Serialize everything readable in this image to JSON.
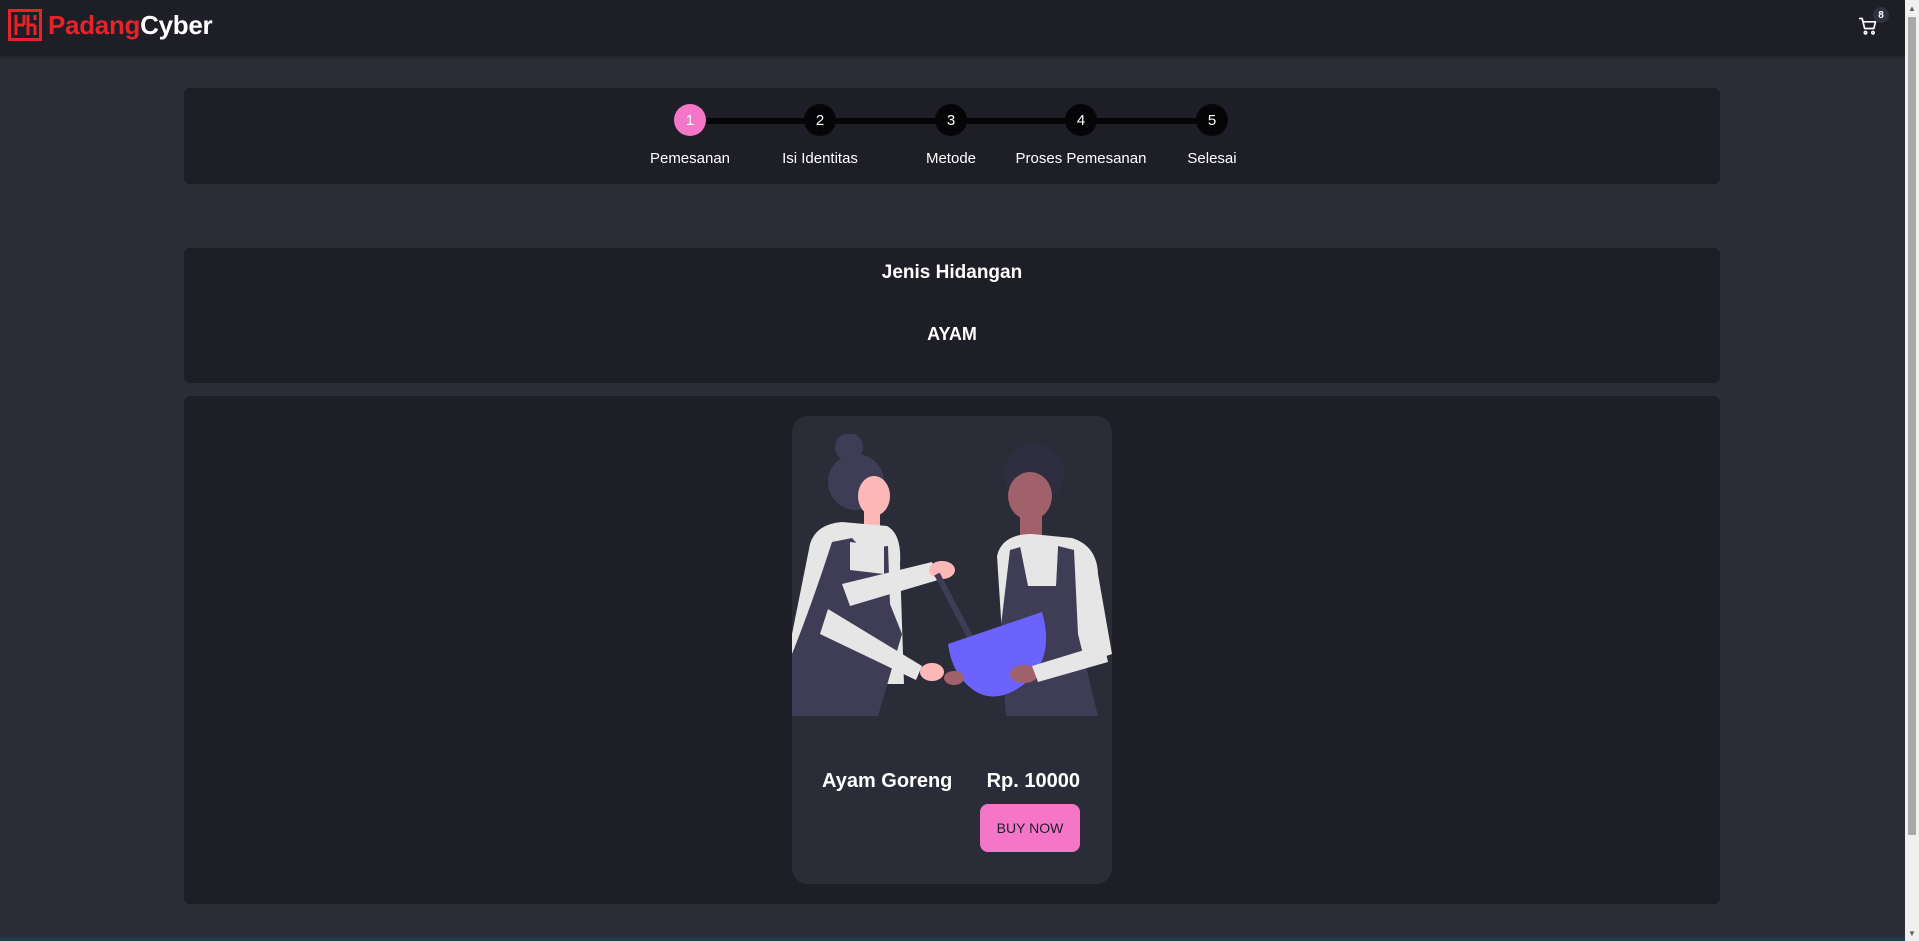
{
  "brand": {
    "part1": "Padang",
    "part2": "Cyber",
    "logo_icon": "padang-logo-icon",
    "red": "#e5232b"
  },
  "cart": {
    "icon": "cart-icon",
    "count": "8"
  },
  "steps": [
    {
      "number": "1",
      "label": "Pemesanan",
      "active": true
    },
    {
      "number": "2",
      "label": "Isi Identitas",
      "active": false
    },
    {
      "number": "3",
      "label": "Metode",
      "active": false
    },
    {
      "number": "4",
      "label": "Proses Pemesanan",
      "active": false
    },
    {
      "number": "5",
      "label": "Selesai",
      "active": false
    }
  ],
  "category": {
    "title": "Jenis Hidangan",
    "value": "AYAM"
  },
  "products": [
    {
      "name": "Ayam Goreng",
      "price": "Rp. 10000",
      "button_label": "BUY NOW",
      "image": "cooking-illustration"
    }
  ],
  "colors": {
    "accent": "#f576c8",
    "panel": "#1d1e26",
    "background": "#2a2c38"
  }
}
